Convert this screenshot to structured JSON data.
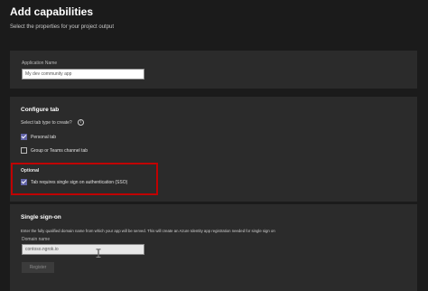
{
  "header": {
    "title": "Add capabilities",
    "subtitle": "Select the properties for your project output"
  },
  "app_name_section": {
    "label": "Application Name",
    "value": "My dev community app"
  },
  "configure_tab": {
    "title": "Configure tab",
    "question": "Select tab type to create?",
    "options": [
      {
        "label": "Personal tab",
        "checked": true
      },
      {
        "label": "Group or Teams channel tab",
        "checked": false
      }
    ],
    "optional_label": "Optional",
    "sso_option": {
      "label": "Tab requires single sign on authentication (SSO)",
      "checked": true
    }
  },
  "single_sign_on": {
    "title": "Single sign-on",
    "description": "Enter the fully qualified domain name from which your app will be served. This will create an Azure Identity app registration needed for single sign on",
    "domain_label": "Domain name",
    "domain_value": "contoso.ngrok.io",
    "register_label": "Register"
  },
  "colors": {
    "background": "#1b1b1b",
    "card": "#2b2b2b",
    "accent": "#6264a7",
    "highlight": "#c00000"
  }
}
